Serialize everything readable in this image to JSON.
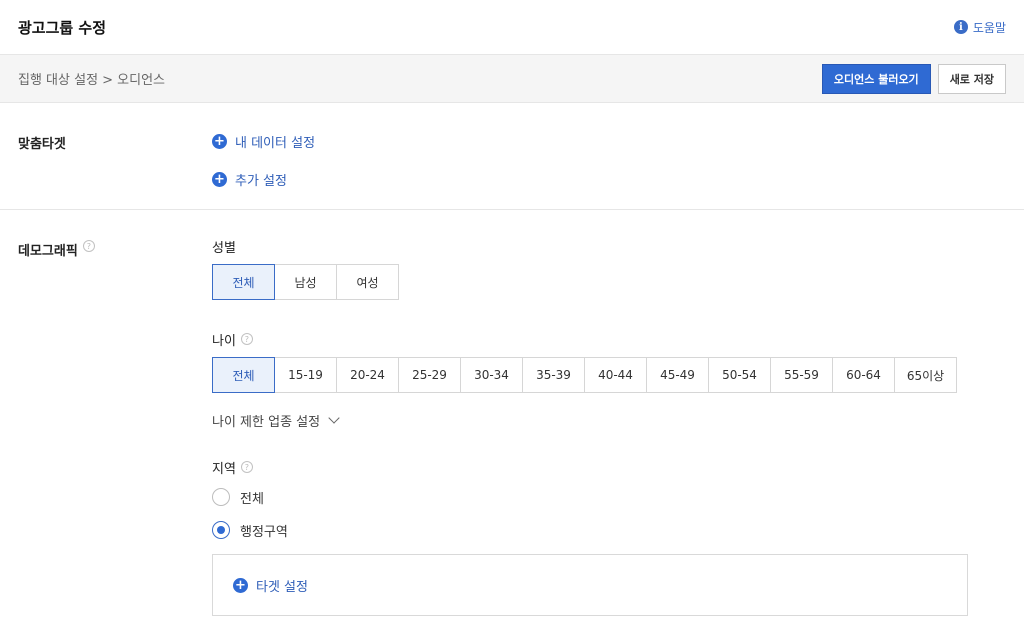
{
  "header": {
    "title": "광고그룹 수정",
    "help_label": "도움말",
    "help_icon": "info-icon"
  },
  "subbar": {
    "breadcrumb": "집행 대상 설정 > 오디언스",
    "load_audience_label": "오디언스 불러오기",
    "save_new_label": "새로 저장"
  },
  "custom_target": {
    "label": "맞춤타겟",
    "links": [
      "내 데이터 설정",
      "추가 설정"
    ]
  },
  "demographic": {
    "label": "데모그래픽",
    "gender": {
      "title": "성별",
      "options": [
        "전체",
        "남성",
        "여성"
      ],
      "selected": "전체"
    },
    "age": {
      "title": "나이",
      "options": [
        "전체",
        "15-19",
        "20-24",
        "25-29",
        "30-34",
        "35-39",
        "40-44",
        "45-49",
        "50-54",
        "55-59",
        "60-64",
        "65이상"
      ],
      "selected": "전체",
      "limit_toggle": "나이 제한 업종 설정"
    },
    "region": {
      "title": "지역",
      "options": [
        "전체",
        "행정구역"
      ],
      "selected": "행정구역",
      "target_link": "타겟 설정"
    }
  },
  "colors": {
    "accent": "#2f6ad3",
    "link": "#2f5eb8",
    "border": "#d6d6d6"
  }
}
